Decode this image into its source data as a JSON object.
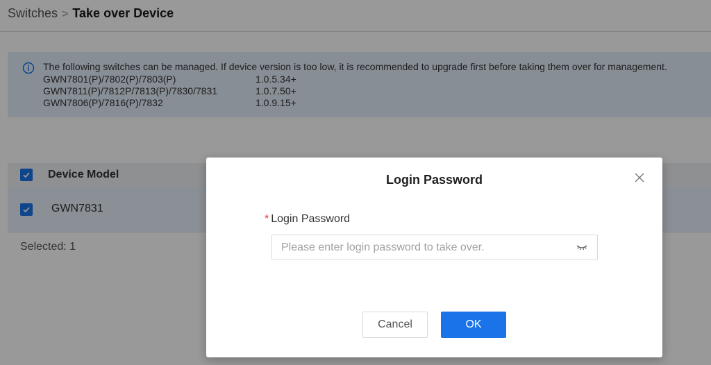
{
  "breadcrumb": {
    "parent": "Switches",
    "separator": ">",
    "current": "Take over Device"
  },
  "info_banner": {
    "icon": "info-icon",
    "message": "The following switches can be managed. If device version is too low, it is recommended to upgrade first before taking them over for management.",
    "rows": [
      {
        "models": "GWN7801(P)/7802(P)/7803(P)",
        "version": "1.0.5.34+"
      },
      {
        "models": "GWN7811(P)/7812P/7813(P)/7830/7831",
        "version": "1.0.7.50+"
      },
      {
        "models": "GWN7806(P)/7816(P)/7832",
        "version": "1.0.9.15+"
      }
    ]
  },
  "table": {
    "header": {
      "column": "Device Model",
      "checked": true
    },
    "rows": [
      {
        "model": "GWN7831",
        "checked": true
      }
    ],
    "selected_text": "Selected: 1"
  },
  "modal": {
    "title": "Login Password",
    "field_label": "Login Password",
    "required_marker": "*",
    "placeholder": "Please enter login password to take over.",
    "value": "",
    "cancel_label": "Cancel",
    "ok_label": "OK"
  },
  "colors": {
    "accent": "#1a73e8",
    "banner_bg": "#e3edfb",
    "required": "#e53935"
  }
}
